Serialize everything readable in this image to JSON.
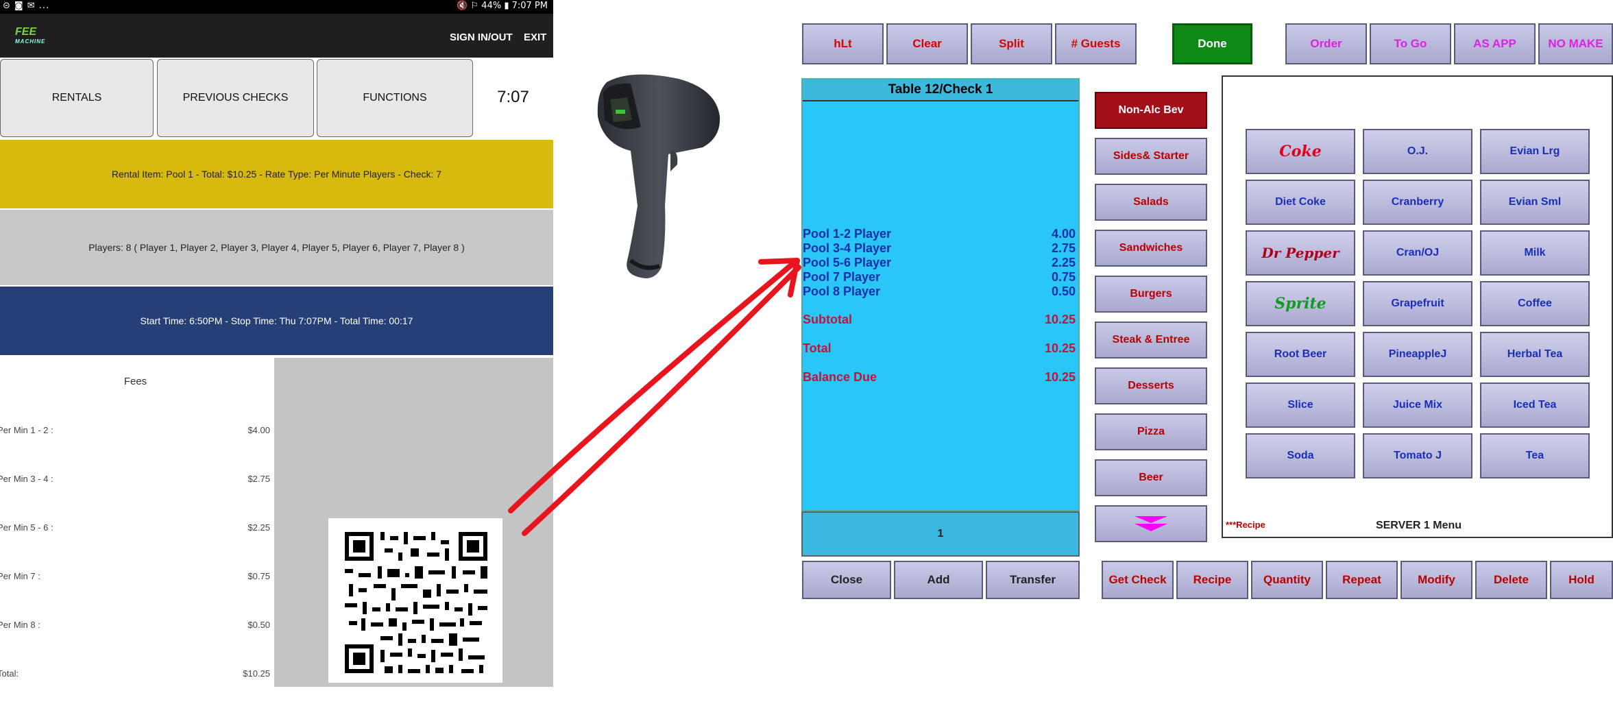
{
  "phone": {
    "status_left": "⊝ ◙ ✉ ...",
    "status_right": "🔇 ⚐ 44% ▮ 7:07 PM",
    "logo_text": "FEE",
    "logo_sub": "MACHINE",
    "sign_in_out": "SIGN IN/OUT",
    "exit": "EXIT",
    "tiles": [
      "RENTALS",
      "PREVIOUS CHECKS",
      "FUNCTIONS"
    ],
    "clock": "7:07",
    "rental_line": "Rental Item: Pool 1 - Total: $10.25 - Rate Type: Per Minute Players - Check: 7",
    "players_line": "Players: 8 ( Player 1, Player 2, Player 3, Player 4, Player 5, Player 6, Player 7, Player 8 )",
    "time_line": "Start Time: 6:50PM - Stop Time: Thu 7:07PM - Total Time: 00:17",
    "fees_title": "Fees",
    "fees": [
      {
        "label": "Per Min 1 - 2 :",
        "value": "$4.00"
      },
      {
        "label": "Per Min 3 - 4 :",
        "value": "$2.75"
      },
      {
        "label": "Per Min 5 - 6 :",
        "value": "$2.25"
      },
      {
        "label": "Per Min 7 :",
        "value": "$0.75"
      },
      {
        "label": "Per Min 8 :",
        "value": "$0.50"
      },
      {
        "label": "Total:",
        "value": "$10.25"
      }
    ]
  },
  "pos": {
    "top_buttons": [
      "hLt",
      "Clear",
      "Split",
      "# Guests"
    ],
    "done": "Done",
    "right_buttons": [
      "Order",
      "To Go",
      "AS APP",
      "NO MAKE"
    ],
    "check_title": "Table 12/Check 1",
    "items": [
      {
        "name": "Pool 1-2 Player",
        "price": "4.00"
      },
      {
        "name": "Pool 3-4 Player",
        "price": "2.75"
      },
      {
        "name": "Pool 5-6 Player",
        "price": "2.25"
      },
      {
        "name": "Pool 7 Player",
        "price": "0.75"
      },
      {
        "name": "Pool 8 Player",
        "price": "0.50"
      }
    ],
    "totals": [
      {
        "name": "Subtotal",
        "value": "10.25"
      },
      {
        "name": "Total",
        "value": "10.25"
      },
      {
        "name": "Balance Due",
        "value": "10.25"
      }
    ],
    "check_footer": "1",
    "categories": [
      "Non-Alc Bev",
      "Sides& Starter",
      "Salads",
      "Sandwiches",
      "Burgers",
      "Steak & Entree",
      "Desserts",
      "Pizza",
      "Beer"
    ],
    "menu_items": [
      "Coke",
      "O.J.",
      "Evian Lrg",
      "Diet Coke",
      "Cranberry",
      "Evian Sml",
      "Dr Pepper",
      "Cran/OJ",
      "Milk",
      "Sprite",
      "Grapefruit",
      "Coffee",
      "Root Beer",
      "PineappleJ",
      "Herbal Tea",
      "Slice",
      "Juice Mix",
      "Iced Tea",
      "Soda",
      "Tomato J",
      "Tea"
    ],
    "recipe_note": "***Recipe",
    "menu_title": "SERVER 1 Menu",
    "bottom_left": [
      "Close",
      "Add",
      "Transfer"
    ],
    "bottom_right": [
      "Get Check",
      "Recipe",
      "Quantity",
      "Repeat",
      "Modify",
      "Delete",
      "Hold"
    ]
  }
}
